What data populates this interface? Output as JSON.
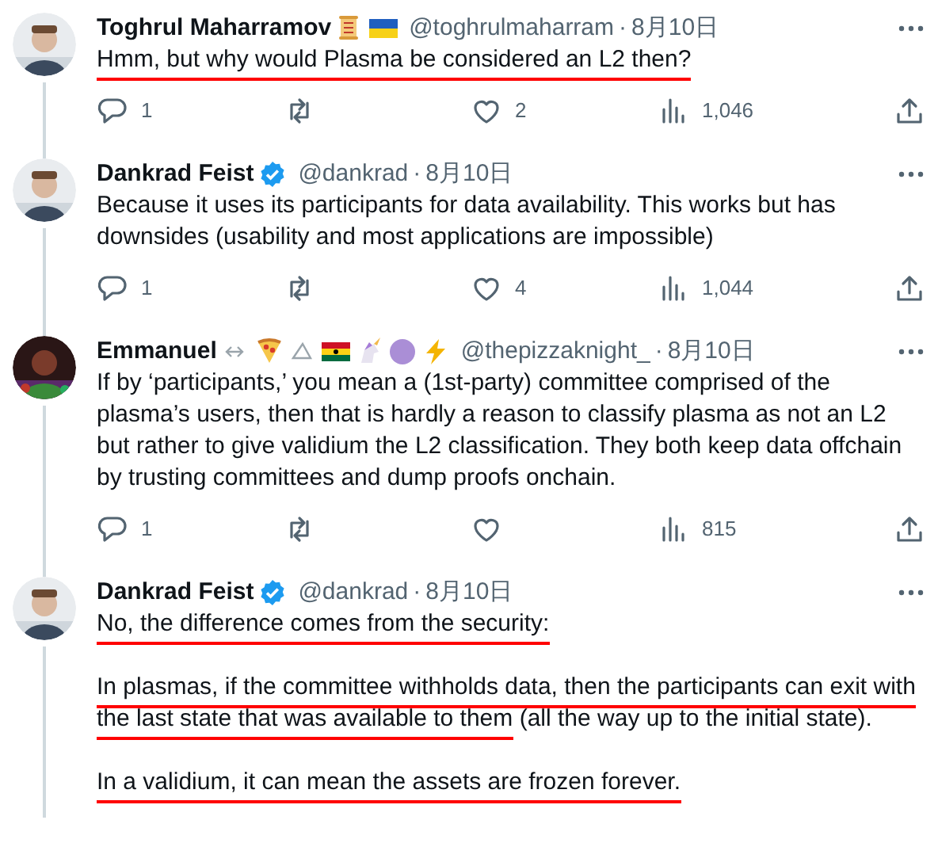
{
  "tweets": [
    {
      "name": "Toghrul Maharramov",
      "handle": "@toghrulmaharram",
      "separator": "·",
      "date": "8月10日",
      "avatar": {
        "kind": "picture"
      },
      "paragraphs": [
        {
          "segments": [
            {
              "text": "Hmm, but why would Plasma be considered an L2 then?",
              "underlined": true
            }
          ]
        }
      ],
      "actions": {
        "replies": "1",
        "likes": "2",
        "views": "1,046"
      }
    },
    {
      "name": "Dankrad Feist",
      "verified": true,
      "handle": "@dankrad",
      "separator": "·",
      "date": "8月10日",
      "avatar": {
        "kind": "picture"
      },
      "paragraphs": [
        {
          "segments": [
            {
              "text": "Because it uses its participants for data availability. This works but has downsides (usability and most applications are impossible)",
              "underlined": false
            }
          ]
        }
      ],
      "actions": {
        "replies": "1",
        "likes": "4",
        "views": "1,044"
      }
    },
    {
      "name": "Emmanuel",
      "handle": "@thepizzaknight_",
      "separator": "·",
      "date": "8月10日",
      "avatar": {
        "kind": "picture"
      },
      "paragraphs": [
        {
          "segments": [
            {
              "text": "If by ‘participants,’ you mean a (1st-party) committee comprised of the plasma’s users, then that is hardly a reason to classify plasma as not an L2 but rather to give validium the L2 classification. They both keep data offchain by trusting committees and dump proofs onchain.",
              "underlined": false
            }
          ]
        }
      ],
      "actions": {
        "replies": "1",
        "views": "815"
      }
    },
    {
      "name": "Dankrad Feist",
      "verified": true,
      "handle": "@dankrad",
      "separator": "·",
      "date": "8月10日",
      "avatar": {
        "kind": "picture"
      },
      "paragraphs": [
        {
          "segments": [
            {
              "text": "No, the difference comes from the security:",
              "underlined": true
            }
          ]
        },
        {
          "segments": [
            {
              "text": "In plasmas, if the committee withholds data, then the participants can exit with the last state that was available to them",
              "underlined": true
            },
            {
              "text": " (all the way up to the initial state).",
              "underlined": false
            }
          ]
        },
        {
          "segments": [
            {
              "text": "In a validium, it can mean the assets are frozen forever.",
              "underlined": true
            }
          ]
        }
      ]
    }
  ]
}
